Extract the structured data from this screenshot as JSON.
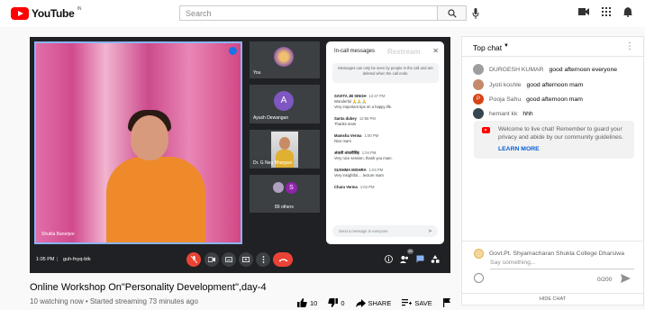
{
  "header": {
    "logo_text": "YouTube",
    "country_code": "IN",
    "search_placeholder": "Search",
    "icons": [
      "search-icon",
      "mic-icon",
      "create-video-icon",
      "apps-grid-icon",
      "notifications-icon"
    ]
  },
  "player": {
    "speaker_name": "Shukla Banerjee",
    "participants": [
      {
        "name": "You",
        "kind": "photo"
      },
      {
        "name": "Ayush Dewangan",
        "initial": "A",
        "color": "#7e57c2"
      },
      {
        "name": "Dr. G Neg Bhargavi",
        "kind": "photo"
      },
      {
        "name": "89 others",
        "initial": "S",
        "color": "#8e24aa"
      }
    ],
    "meeting": {
      "time": "1:05 PM",
      "separator": "|",
      "code": "guh-fnyq-btk",
      "chat_badge_count": "89"
    },
    "in_call_chat": {
      "title": "In-call messages",
      "watermark": "Restream",
      "notice": "Messages can only be seen by people in the call and are deleted when the call ends.",
      "messages": [
        {
          "sender": "SAVITA JB SINGH",
          "time": "12:47 PM",
          "lines": [
            "Wonderful 🙏🙏🙏",
            "Very important tips on a happy life."
          ]
        },
        {
          "sender": "Santa dubey",
          "time": "12:56 PM",
          "lines": [
            "Thanks mam"
          ]
        },
        {
          "sender": "Mamsha Verma",
          "time": "1:00 PM",
          "lines": [
            "Nice mam"
          ]
        },
        {
          "sender": "अंजली अंजलीसिंह",
          "time": "1:04 PM",
          "lines": [
            "Very nice session, thank you mam."
          ]
        },
        {
          "sender": "SUSHMA MISHRA",
          "time": "1:04 PM",
          "lines": [
            "Very insightful.... lecture mam"
          ]
        },
        {
          "sender": "Charu Verma",
          "time": "1:04 PM",
          "lines": [
            ""
          ]
        }
      ],
      "input_placeholder": "Send a message to everyone"
    }
  },
  "video": {
    "title": "Online Workshop On\"Personality Development\",day-4",
    "meta": "10 watching now • Started streaming 73 minutes ago",
    "likes": "10",
    "dislikes": "0",
    "share_label": "SHARE",
    "save_label": "SAVE"
  },
  "live_chat": {
    "header": "Top chat",
    "messages": [
      {
        "author": "DURGESH KUMAR",
        "text": "good afternoon everyone",
        "avatar_color": "#9e9e9e",
        "initial": ""
      },
      {
        "author": "Jyoti koshle",
        "text": "good afternoon mam",
        "avatar_color": "#c48a6a",
        "initial": ""
      },
      {
        "author": "Pooja Sahu",
        "text": "good afternoon mam",
        "avatar_color": "#d84315",
        "initial": "P"
      },
      {
        "author": "hemant kk",
        "text": "hhh",
        "avatar_color": "#37474f",
        "initial": ""
      }
    ],
    "welcome_text": "Welcome to live chat! Remember to guard your privacy and abide by our community guidelines.",
    "learn_more": "LEARN MORE",
    "current_user": "Govt.Pt. Shyamacharan Shukla College Dharsiwa",
    "input_placeholder": "Say something...",
    "char_count": "0/200",
    "hide_chat": "HIDE CHAT"
  },
  "colors": {
    "youtube_red": "#ff0000",
    "meet_blue": "#8ab4f8",
    "link_blue": "#065fd4",
    "hangup_red": "#ea4335"
  }
}
